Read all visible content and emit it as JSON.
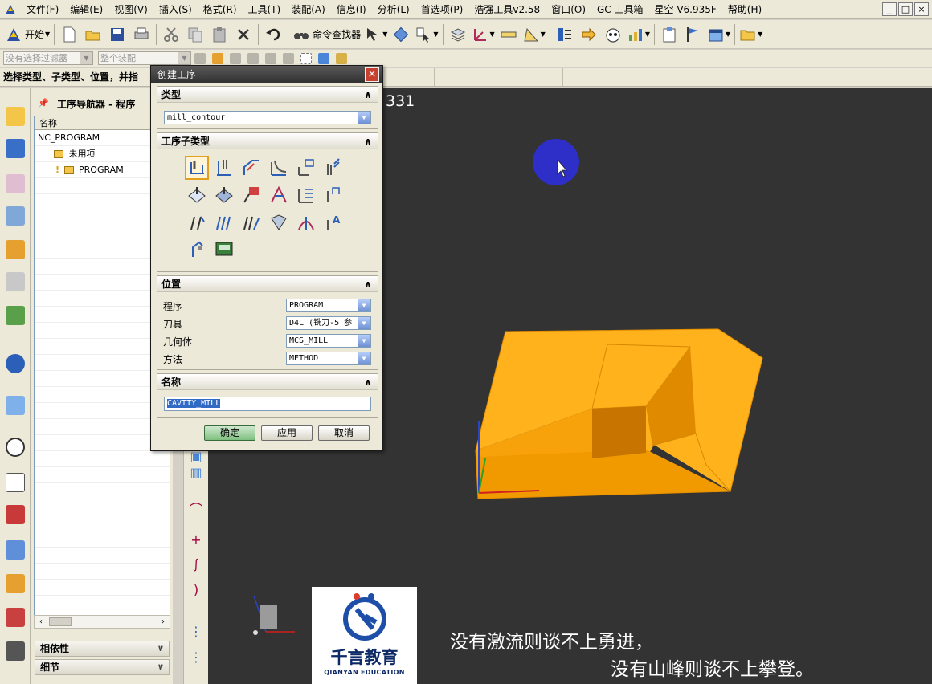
{
  "menubar": {
    "items": [
      "文件(F)",
      "编辑(E)",
      "视图(V)",
      "插入(S)",
      "格式(R)",
      "工具(T)",
      "装配(A)",
      "信息(I)",
      "分析(L)",
      "首选项(P)",
      "浩强工具v2.58",
      "窗口(O)",
      "GC 工具箱",
      "星空 V6.935F",
      "帮助(H)"
    ],
    "window_buttons": [
      "_",
      "□",
      "×"
    ]
  },
  "toolbar1": {
    "start_label": "开始",
    "command_finder_label": "命令查找器"
  },
  "toolbar2": {
    "filter_placeholder": "没有选择过滤器",
    "assembly_placeholder": "整个装配"
  },
  "cue_line": "选择类型、子类型、位置，并指",
  "navigator": {
    "title": "工序导航器 - 程序",
    "column_name": "名称",
    "rows": [
      "NC_PROGRAM",
      "未用项",
      "PROGRAM"
    ],
    "folds": [
      "相依性",
      "细节"
    ]
  },
  "graphics": {
    "overlay_number": "331"
  },
  "dialog": {
    "title": "创建工序",
    "close": "×",
    "type_group": "类型",
    "type_value": "mill_contour",
    "subtype_group": "工序子类型",
    "location_group": "位置",
    "program_label": "程序",
    "program_value": "PROGRAM",
    "tool_label": "刀具",
    "tool_value": "D4L (铣刀-5 参",
    "geometry_label": "几何体",
    "geometry_value": "MCS_MILL",
    "method_label": "方法",
    "method_value": "METHOD",
    "name_group": "名称",
    "name_value": "CAVITY_MILL",
    "ok": "确定",
    "apply": "应用",
    "cancel": "取消"
  },
  "logo": {
    "brand_cn": "千言教育",
    "brand_en": "QIANYAN EDUCATION"
  },
  "subtitles": {
    "line1": "没有激流则谈不上勇进，",
    "line2": "没有山峰则谈不上攀登。"
  },
  "colors": {
    "part_top": "#ffb21c",
    "part_side": "#f09a00",
    "part_dark": "#c77400",
    "viewport_bg": "#333333",
    "cursor_highlight": "#2d2fc8"
  }
}
